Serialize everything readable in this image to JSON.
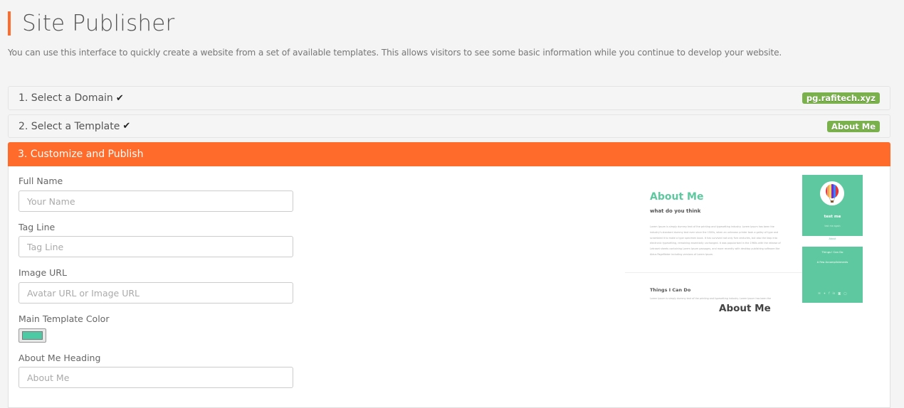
{
  "page": {
    "title": "Site Publisher",
    "intro": "You can use this interface to quickly create a website from a set of available templates. This allows visitors to see some basic information while you continue to develop your website."
  },
  "accent_color": "#ff6b2b",
  "steps": [
    {
      "label": "1. Select a Domain",
      "completed": true,
      "icon": "check-icon",
      "badge": "pg.rafitech.xyz"
    },
    {
      "label": "2. Select a Template",
      "completed": true,
      "icon": "check-icon",
      "badge": "About Me"
    },
    {
      "label": "3. Customize and Publish",
      "active": true
    }
  ],
  "form": {
    "full_name": {
      "label": "Full Name",
      "placeholder": "Your Name",
      "value": ""
    },
    "tag_line": {
      "label": "Tag Line",
      "placeholder": "Tag Line",
      "value": ""
    },
    "image_url": {
      "label": "Image URL",
      "placeholder": "Avatar URL or Image URL",
      "value": ""
    },
    "main_color": {
      "label": "Main Template Color",
      "value": "#4ccaa3"
    },
    "about_heading": {
      "label": "About Me Heading",
      "placeholder": "About Me",
      "value": ""
    }
  },
  "preview": {
    "heading": "About Me",
    "subheading": "what do you think",
    "lorem": "Lorem Ipsum is simply dummy text of the printing and typesetting industry. Lorem Ipsum has been the industry's standard dummy text ever since the 1500s, when an unknown printer took a galley of type and scrambled it to make a type specimen book. It has survived not only five centuries, but also the leap into electronic typesetting, remaining essentially unchanged. It was popularised in the 1960s with the release of Letraset sheets containing Lorem Ipsum passages, and more recently with desktop publishing software like Aldus PageMaker including versions of Lorem Ipsum.",
    "things_heading": "Things I Can Do",
    "things_lorem": "Lorem Ipsum is simply dummy text of the printing and typesetting industry. Lorem Ipsum has been the",
    "side_name": "test me",
    "side_tagline": "test me again",
    "side_about_link": "About",
    "side_things": "Things I Can Do",
    "side_accomplishments": "A Few Accomplishments",
    "social_icons": [
      "envelope-icon",
      "twitter-icon",
      "facebook-icon",
      "linkedin-icon",
      "instagram-icon",
      "github-icon"
    ],
    "social_glyphs": [
      "✉",
      "🐦",
      "f",
      "in",
      "◙",
      "◯"
    ],
    "theme_color": "#5ec9a0",
    "caption": "About Me"
  }
}
